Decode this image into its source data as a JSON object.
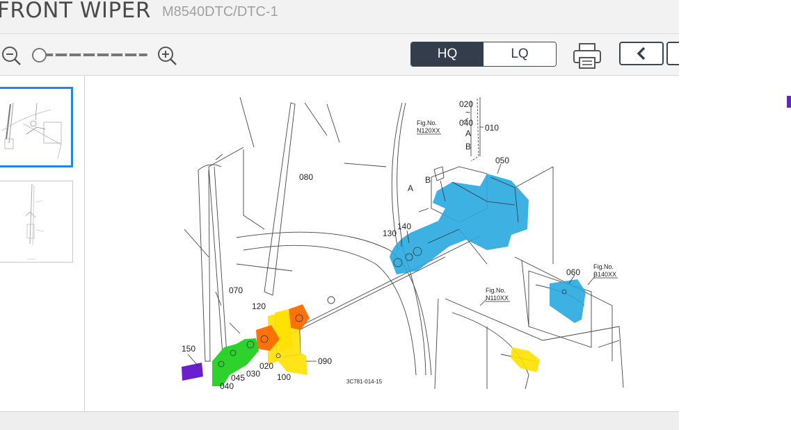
{
  "header": {
    "title": "FRONT WIPER",
    "model": "M8540DTC/DTC-1"
  },
  "toolbar": {
    "hq_label": "HQ",
    "lq_label": "LQ"
  },
  "colors": {
    "accent_dark": "#333d4b",
    "thumb_selected": "#1e88e5",
    "highlight_blue": "#29a9e0",
    "highlight_green": "#22d022",
    "highlight_yellow": "#ffe100",
    "highlight_orange": "#ff6a00",
    "highlight_purple": "#6a1fd0"
  },
  "icons": [
    "zoom-out-icon",
    "zoom-in-icon",
    "print-icon",
    "chevron-left-icon"
  ],
  "diagram": {
    "part_labels": [
      "020",
      "~",
      "040",
      "A",
      "B",
      "010",
      "050",
      "A",
      "B",
      "130",
      "140",
      "080",
      "070",
      "120",
      "060",
      "150",
      "045",
      "040",
      "030",
      "020",
      "100",
      "090"
    ],
    "fig_refs": [
      {
        "line1": "Fig.No.",
        "line2": "N120XX"
      },
      {
        "line1": "Fig.No.",
        "line2": "N110XX"
      },
      {
        "line1": "Fig.No.",
        "line2": "B140XX"
      }
    ],
    "drawing_code": "3C781-014-15"
  }
}
